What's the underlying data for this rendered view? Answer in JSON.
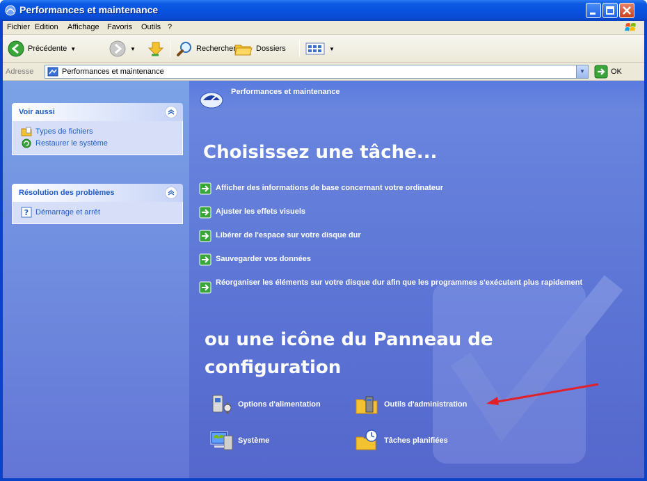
{
  "window": {
    "title": "Performances et maintenance"
  },
  "menu": {
    "items": [
      "Fichier",
      "Edition",
      "Affichage",
      "Favoris",
      "Outils",
      "?"
    ]
  },
  "toolbar": {
    "back_label": "Précédente",
    "search_label": "Rechercher",
    "folders_label": "Dossiers"
  },
  "address": {
    "label": "Adresse",
    "value": "Performances et maintenance",
    "go_label": "OK"
  },
  "sidebar": {
    "see_also": {
      "title": "Voir aussi",
      "links": [
        "Types de fichiers",
        "Restaurer le système"
      ]
    },
    "troubleshoot": {
      "title": "Résolution des problèmes",
      "links": [
        "Démarrage et arrêt"
      ]
    }
  },
  "content": {
    "category_title": "Performances et maintenance",
    "task_heading": "Choisissez une tâche...",
    "tasks": [
      "Afficher des informations de base concernant votre ordinateur",
      "Ajuster les effets visuels",
      "Libérer de l'espace sur votre disque dur",
      "Sauvegarder vos données",
      "Réorganiser les éléments sur votre disque dur afin que les programmes s'exécutent plus rapidement"
    ],
    "icon_heading": "ou une icône du Panneau de configuration",
    "icons": [
      {
        "label": "Options d'alimentation",
        "icon": "power-options-icon"
      },
      {
        "label": "Outils d'administration",
        "icon": "admin-tools-icon"
      },
      {
        "label": "Système",
        "icon": "system-icon"
      },
      {
        "label": "Tâches planifiées",
        "icon": "scheduled-tasks-icon"
      }
    ]
  },
  "colors": {
    "titlebar": "#0753e0",
    "pane_left": "#6375d6",
    "content_bg": "#5b73d4",
    "link_blue": "#215dc6",
    "annotation_red": "#e0202a"
  }
}
